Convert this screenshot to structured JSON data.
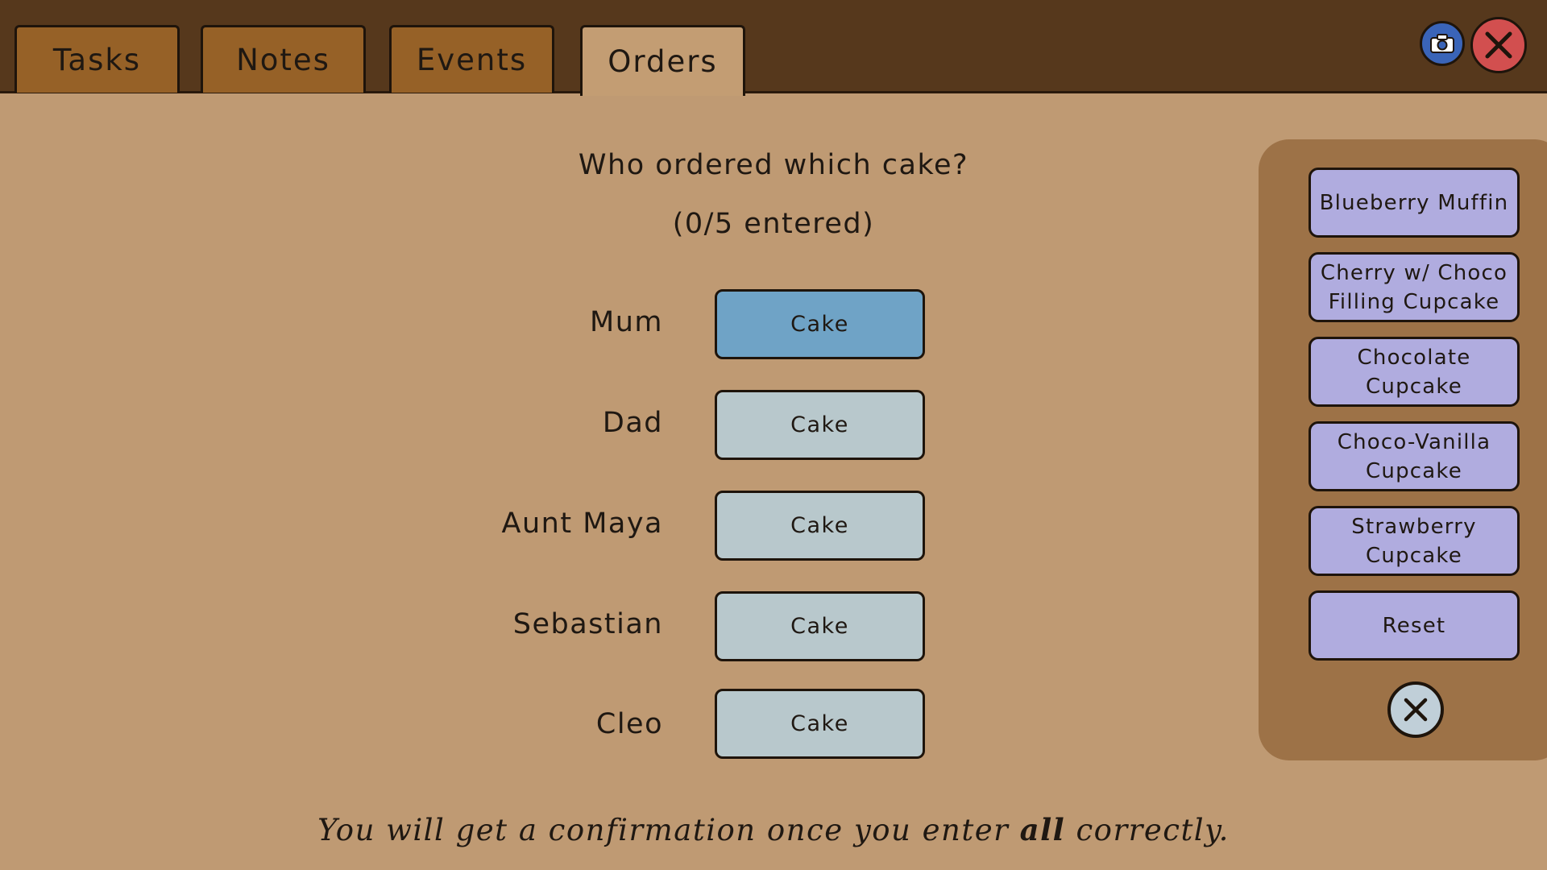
{
  "tabs": [
    "Tasks",
    "Notes",
    "Events",
    "Orders"
  ],
  "active_tab": "Orders",
  "header": {
    "question": "Who ordered which cake?",
    "counter": "(0/5 entered)"
  },
  "rows": [
    {
      "name": "Mum",
      "slot": "Cake",
      "selected": true
    },
    {
      "name": "Dad",
      "slot": "Cake",
      "selected": false
    },
    {
      "name": "Aunt Maya",
      "slot": "Cake",
      "selected": false
    },
    {
      "name": "Sebastian",
      "slot": "Cake",
      "selected": false
    },
    {
      "name": "Cleo",
      "slot": "Cake",
      "selected": false
    }
  ],
  "options": [
    "Blueberry Muffin",
    "Cherry w/ Choco Filling Cupcake",
    "Chocolate Cupcake",
    "Choco-Vanilla Cupcake",
    "Strawberry Cupcake",
    "Reset"
  ],
  "hint": {
    "before": "You will get a confirmation once you enter ",
    "emphasis": "all",
    "after": " correctly."
  },
  "icons": {
    "camera": "camera-icon",
    "close": "close-icon",
    "panel_close": "close-circle-icon"
  },
  "colors": {
    "background": "#bf9a73",
    "topbar": "#56381c",
    "tab": "#966127",
    "slot": "#b8c8cc",
    "slot_selected": "#6fa3c6",
    "option": "#b0acdf",
    "panel": "#9d7247",
    "close_button": "#d24f4f",
    "camera_button": "#3a64b8"
  }
}
